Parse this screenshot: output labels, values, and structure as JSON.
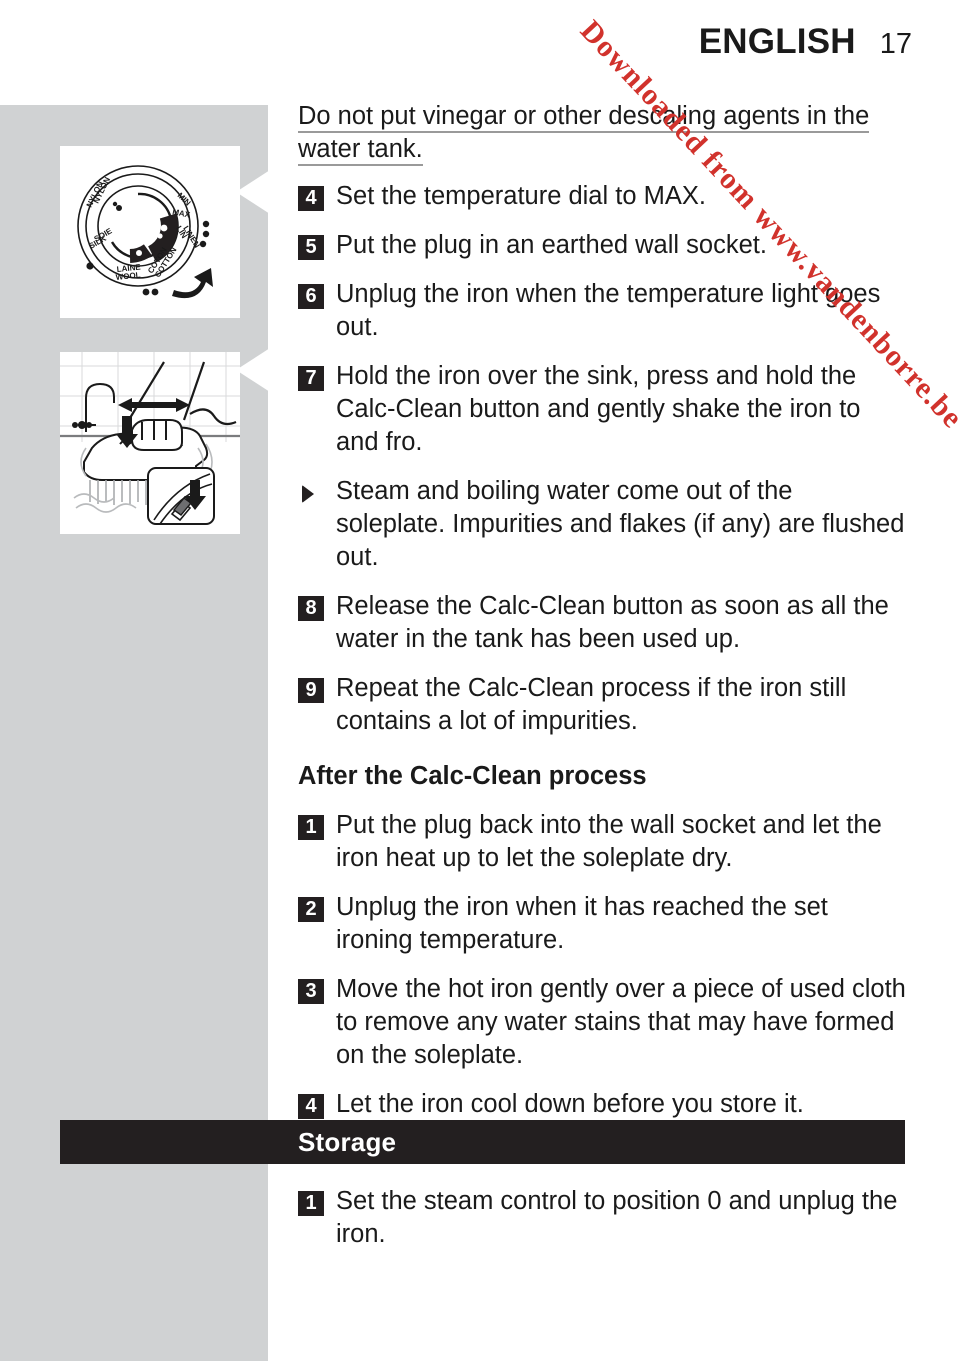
{
  "header": {
    "title": "ENGLISH",
    "page_number": "17"
  },
  "watermark": {
    "text": "Downloaded from www.vandenborre.be",
    "color": "#d1322c"
  },
  "colors": {
    "sidebar_gray": "#d0d2d3",
    "ink": "#1a1a1a",
    "bar_black": "#231f20",
    "rule_gray": "#9a9a9a"
  },
  "main": {
    "lede": "Do not put vinegar or other descaling agents in the water tank.",
    "steps": [
      {
        "marker": "4",
        "type": "number",
        "text": "Set the temperature dial to MAX."
      },
      {
        "marker": "5",
        "type": "number",
        "text": "Put the plug in an earthed wall socket."
      },
      {
        "marker": "6",
        "type": "number",
        "text": "Unplug the iron when the temperature light goes out."
      },
      {
        "marker": "7",
        "type": "number",
        "text": "Hold the iron over the sink, press and hold the Calc-Clean button and gently shake the iron to and fro."
      },
      {
        "marker": "",
        "type": "bullet",
        "text": "Steam and boiling water come out of the soleplate. Impurities and flakes (if any) are flushed out."
      },
      {
        "marker": "8",
        "type": "number",
        "text": "Release the Calc-Clean button as soon as all the water in the tank has been used up."
      },
      {
        "marker": "9",
        "type": "number",
        "text": "Repeat the Calc-Clean process if the iron still contains a lot of impurities."
      }
    ],
    "subheading": "After the Calc-Clean process",
    "after_steps": [
      {
        "marker": "1",
        "type": "number",
        "text": "Put the plug back into the wall socket and let the iron heat up to let the soleplate dry."
      },
      {
        "marker": "2",
        "type": "number",
        "text": "Unplug the iron when it has reached the set ironing temperature."
      },
      {
        "marker": "3",
        "type": "number",
        "text": "Move the hot iron gently over a piece of used cloth to remove any water stains that may have formed on the soleplate."
      },
      {
        "marker": "4",
        "type": "number",
        "text": "Let the iron cool down before you store it."
      }
    ]
  },
  "storage": {
    "bar_label": "Storage",
    "steps": [
      {
        "marker": "1",
        "type": "number",
        "text": "Set the steam control to position 0 and unplug the iron."
      }
    ]
  },
  "illustrations": {
    "dial": {
      "name": "temperature-dial",
      "labels": {
        "min": "MIN",
        "max": "MAX",
        "nylon_fr": "NYLON",
        "nylon_en": "NYLON",
        "silk_fr": "SOIE",
        "silk_en": "SILK",
        "wool_fr": "LAINE",
        "wool_en": "WOOL",
        "cotton_fr": "COTON",
        "cotton_en": "COTTON",
        "linen_fr": "LIN",
        "linen_en": "LINEN"
      }
    },
    "sink": {
      "name": "iron-over-sink-shake"
    }
  }
}
